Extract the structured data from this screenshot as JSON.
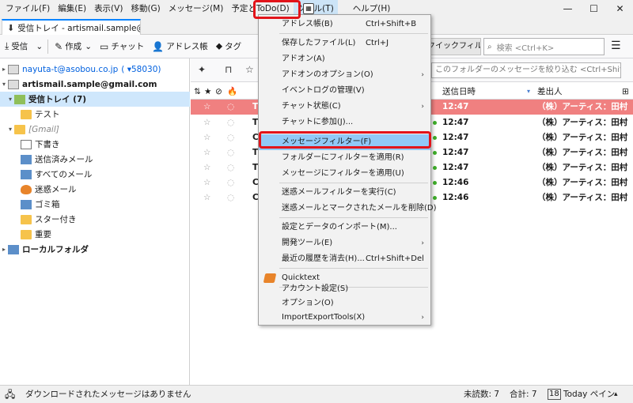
{
  "menubar": [
    "ファイル(F)",
    "編集(E)",
    "表示(V)",
    "移動(G)",
    "メッセージ(M)",
    "予定とToDo(D)",
    "ツール(T)",
    "ヘルプ(H)"
  ],
  "window": {
    "minimize": "—",
    "maximize": "☐",
    "close": "✕"
  },
  "tab": {
    "label": "受信トレイ - artismail.sample@g"
  },
  "toolbar": {
    "get": "受信",
    "write": "作成",
    "chat": "チャット",
    "address": "アドレス帳",
    "tag": "タグ",
    "quickfilter": "クイックフィルター",
    "search_placeholder": "検索 <Ctrl+K>"
  },
  "filter_placeholder": "このフォルダーのメッセージを絞り込む <Ctrl+Shift+K>",
  "folders": {
    "account1": "nayuta-t@asobou.co.jp",
    "account1_count": "( ▾58030)",
    "account2": "artismail.sample@gmail.com",
    "inbox": "受信トレイ (7)",
    "test": "テスト",
    "gmail": "[Gmail]",
    "drafts": "下書き",
    "sent": "送信済みメール",
    "all": "すべてのメール",
    "spam": "迷惑メール",
    "trash": "ゴミ箱",
    "starred": "スター付き",
    "important": "重要",
    "local": "ローカルフォルダ"
  },
  "columns": {
    "date": "送信日時",
    "from": "差出人"
  },
  "messages": [
    {
      "initial": "T",
      "time": "12:47",
      "from": "（株）アーティス：田村"
    },
    {
      "initial": "T",
      "time": "12:47",
      "from": "（株）アーティス：田村"
    },
    {
      "initial": "C",
      "time": "12:47",
      "from": "（株）アーティス：田村"
    },
    {
      "initial": "T",
      "time": "12:47",
      "from": "（株）アーティス：田村"
    },
    {
      "initial": "T",
      "time": "12:47",
      "from": "（株）アーティス：田村"
    },
    {
      "initial": "C",
      "time": "12:46",
      "from": "（株）アーティス：田村"
    },
    {
      "initial": "C",
      "time": "12:46",
      "from": "（株）アーティス：田村"
    }
  ],
  "tools_menu": [
    {
      "label": "アドレス帳(B)",
      "shortcut": "Ctrl+Shift+B"
    },
    {
      "label": "保存したファイル(L)",
      "shortcut": "Ctrl+J"
    },
    {
      "label": "アドオン(A)",
      "shortcut": ""
    },
    {
      "label": "アドオンのオプション(O)",
      "shortcut": "",
      "submenu": true
    },
    {
      "label": "イベントログの管理(V)",
      "shortcut": ""
    },
    {
      "label": "チャット状態(C)",
      "shortcut": "",
      "submenu": true
    },
    {
      "label": "チャットに参加(J)...",
      "shortcut": ""
    },
    {
      "label": "メッセージフィルター(F)",
      "shortcut": ""
    },
    {
      "label": "フォルダーにフィルターを適用(R)",
      "shortcut": ""
    },
    {
      "label": "メッセージにフィルターを適用(U)",
      "shortcut": ""
    },
    {
      "label": "迷惑メールフィルターを実行(C)",
      "shortcut": ""
    },
    {
      "label": "迷惑メールとマークされたメールを削除(D)",
      "shortcut": ""
    },
    {
      "label": "設定とデータのインポート(M)...",
      "shortcut": ""
    },
    {
      "label": "開発ツール(E)",
      "shortcut": "",
      "submenu": true
    },
    {
      "label": "最近の履歴を消去(H)...",
      "shortcut": "Ctrl+Shift+Del"
    },
    {
      "label": "Quicktext",
      "shortcut": ""
    },
    {
      "label": "アカウント設定(S)",
      "shortcut": ""
    },
    {
      "label": "オプション(O)",
      "shortcut": ""
    },
    {
      "label": "ImportExportTools(X)",
      "shortcut": "",
      "submenu": true
    }
  ],
  "status": {
    "message": "ダウンロードされたメッセージはありません",
    "unread": "未読数: 7",
    "total": "合計: 7",
    "today": "Today ペイン"
  },
  "colors": {
    "highlight_red": "#e2141a",
    "selected_row": "#f08080",
    "menu_hover": "#91c9f7"
  }
}
